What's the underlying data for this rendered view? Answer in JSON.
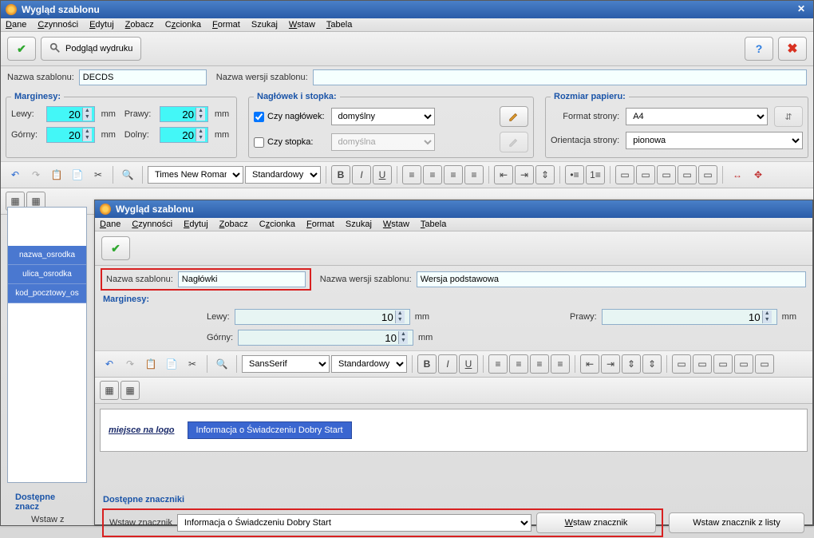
{
  "win1": {
    "title": "Wygląd szablonu",
    "menu": [
      "Dane",
      "Czynności",
      "Edytuj",
      "Zobacz",
      "Czcionka",
      "Format",
      "Szukaj",
      "Wstaw",
      "Tabela"
    ],
    "toolbar_preview": "Podgląd wydruku",
    "name_label": "Nazwa szablonu:",
    "name_value": "DECDS",
    "version_label": "Nazwa wersji szablonu:",
    "version_value": "",
    "margins": {
      "title": "Marginesy:",
      "left_label": "Lewy:",
      "left_value": "20",
      "right_label": "Prawy:",
      "right_value": "20",
      "top_label": "Górny:",
      "top_value": "20",
      "bottom_label": "Dolny:",
      "bottom_value": "20",
      "unit": "mm"
    },
    "headerfooter": {
      "title": "Nagłówek i stopka:",
      "header_chk": "Czy nagłówek:",
      "header_default": "domyślny",
      "footer_chk": "Czy stopka:",
      "footer_default": "domyślna"
    },
    "paper": {
      "title": "Rozmiar papieru:",
      "format_label": "Format strony:",
      "format_value": "A4",
      "orient_label": "Orientacja strony:",
      "orient_value": "pionowa"
    },
    "font_family": "Times New Roman",
    "font_style": "Standardowy",
    "bold": "B",
    "italic": "I",
    "underline": "U",
    "sidebar_items": [
      "nazwa_osrodka",
      "ulica_osrodka",
      "kod_pocztowy_os"
    ],
    "bottom_title": "Dostępne znacz",
    "bottom_label": "Wstaw z"
  },
  "win2": {
    "title": "Wygląd szablonu",
    "menu": [
      "Dane",
      "Czynności",
      "Edytuj",
      "Zobacz",
      "Czcionka",
      "Format",
      "Szukaj",
      "Wstaw",
      "Tabela"
    ],
    "name_label": "Nazwa szablonu:",
    "name_value": "Nagłówki",
    "version_label": "Nazwa wersji szablonu:",
    "version_value": "Wersja podstawowa",
    "margins": {
      "title": "Marginesy:",
      "left_label": "Lewy:",
      "left_value": "10",
      "right_label": "Prawy:",
      "right_value": "10",
      "top_label": "Górny:",
      "top_value": "10",
      "unit": "mm"
    },
    "font_family": "SansSerif",
    "font_style": "Standardowy",
    "logo_text": "miejsce na logo",
    "info_chip": "Informacja o Świadczeniu Dobry Start",
    "available_title": "Dostępne znaczniki",
    "insert_label": "Wstaw znacznik",
    "insert_value": "Informacja o Świadczeniu Dobry Start",
    "insert_btn": "Wstaw znacznik",
    "insert_list_btn": "Wstaw znacznik z listy"
  }
}
